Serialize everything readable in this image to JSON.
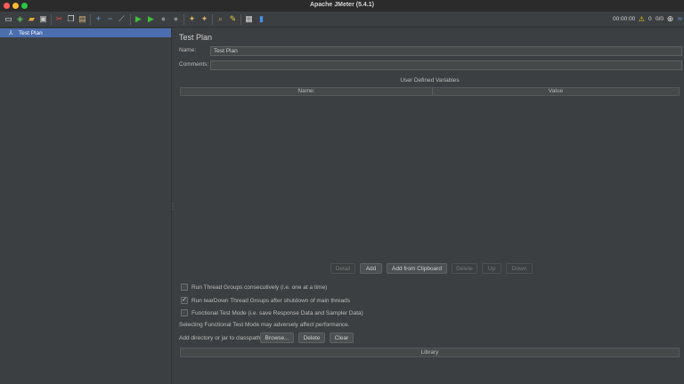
{
  "window": {
    "title": "Apache JMeter (5.4.1)"
  },
  "toolbar": {
    "icons": [
      "new-icon",
      "templates-icon",
      "open-icon",
      "save-icon",
      "cut-icon",
      "copy-icon",
      "paste-icon",
      "expand-icon",
      "collapse-icon",
      "toggle-icon",
      "start-icon",
      "start-no-pause-icon",
      "stop-icon",
      "shutdown-icon",
      "clear-icon",
      "clear-all-icon",
      "search-icon",
      "reset-search-icon",
      "function-helper-icon",
      "help-icon"
    ],
    "timer": "00:00:00",
    "warnings_count": "0",
    "threads": "0/0"
  },
  "tree": {
    "items": [
      {
        "label": "Test Plan",
        "icon": "test-plan-icon",
        "selected": true
      }
    ]
  },
  "test_plan": {
    "title": "Test Plan",
    "name_label": "Name:",
    "name_value": "Test Plan",
    "comments_label": "Comments:",
    "comments_value": "",
    "variables_title": "User Defined Variables",
    "columns": {
      "name": "Name:",
      "value": "Value"
    },
    "buttons": {
      "detail": "Detail",
      "add": "Add",
      "add_from_clipboard": "Add from Clipboard",
      "delete": "Delete",
      "up": "Up",
      "down": "Down"
    },
    "options": {
      "run_consecutively": {
        "label": "Run Thread Groups consecutively (i.e. one at a time)",
        "checked": false
      },
      "run_teardown": {
        "label": "Run tearDown Thread Groups after shutdown of main threads",
        "checked": true
      },
      "functional_mode": {
        "label": "Functional Test Mode (i.e. save Response Data and Sampler Data)",
        "checked": false
      }
    },
    "functional_warning": "Selecting Functional Test Mode may adversely affect performance.",
    "classpath": {
      "label": "Add directory or jar to classpath",
      "browse": "Browse...",
      "delete": "Delete",
      "clear": "Clear",
      "library_header": "Library"
    }
  },
  "colors": {
    "background": "#3c3f41",
    "selection": "#4b6eaf",
    "titlebar": "#2b2b2b"
  }
}
